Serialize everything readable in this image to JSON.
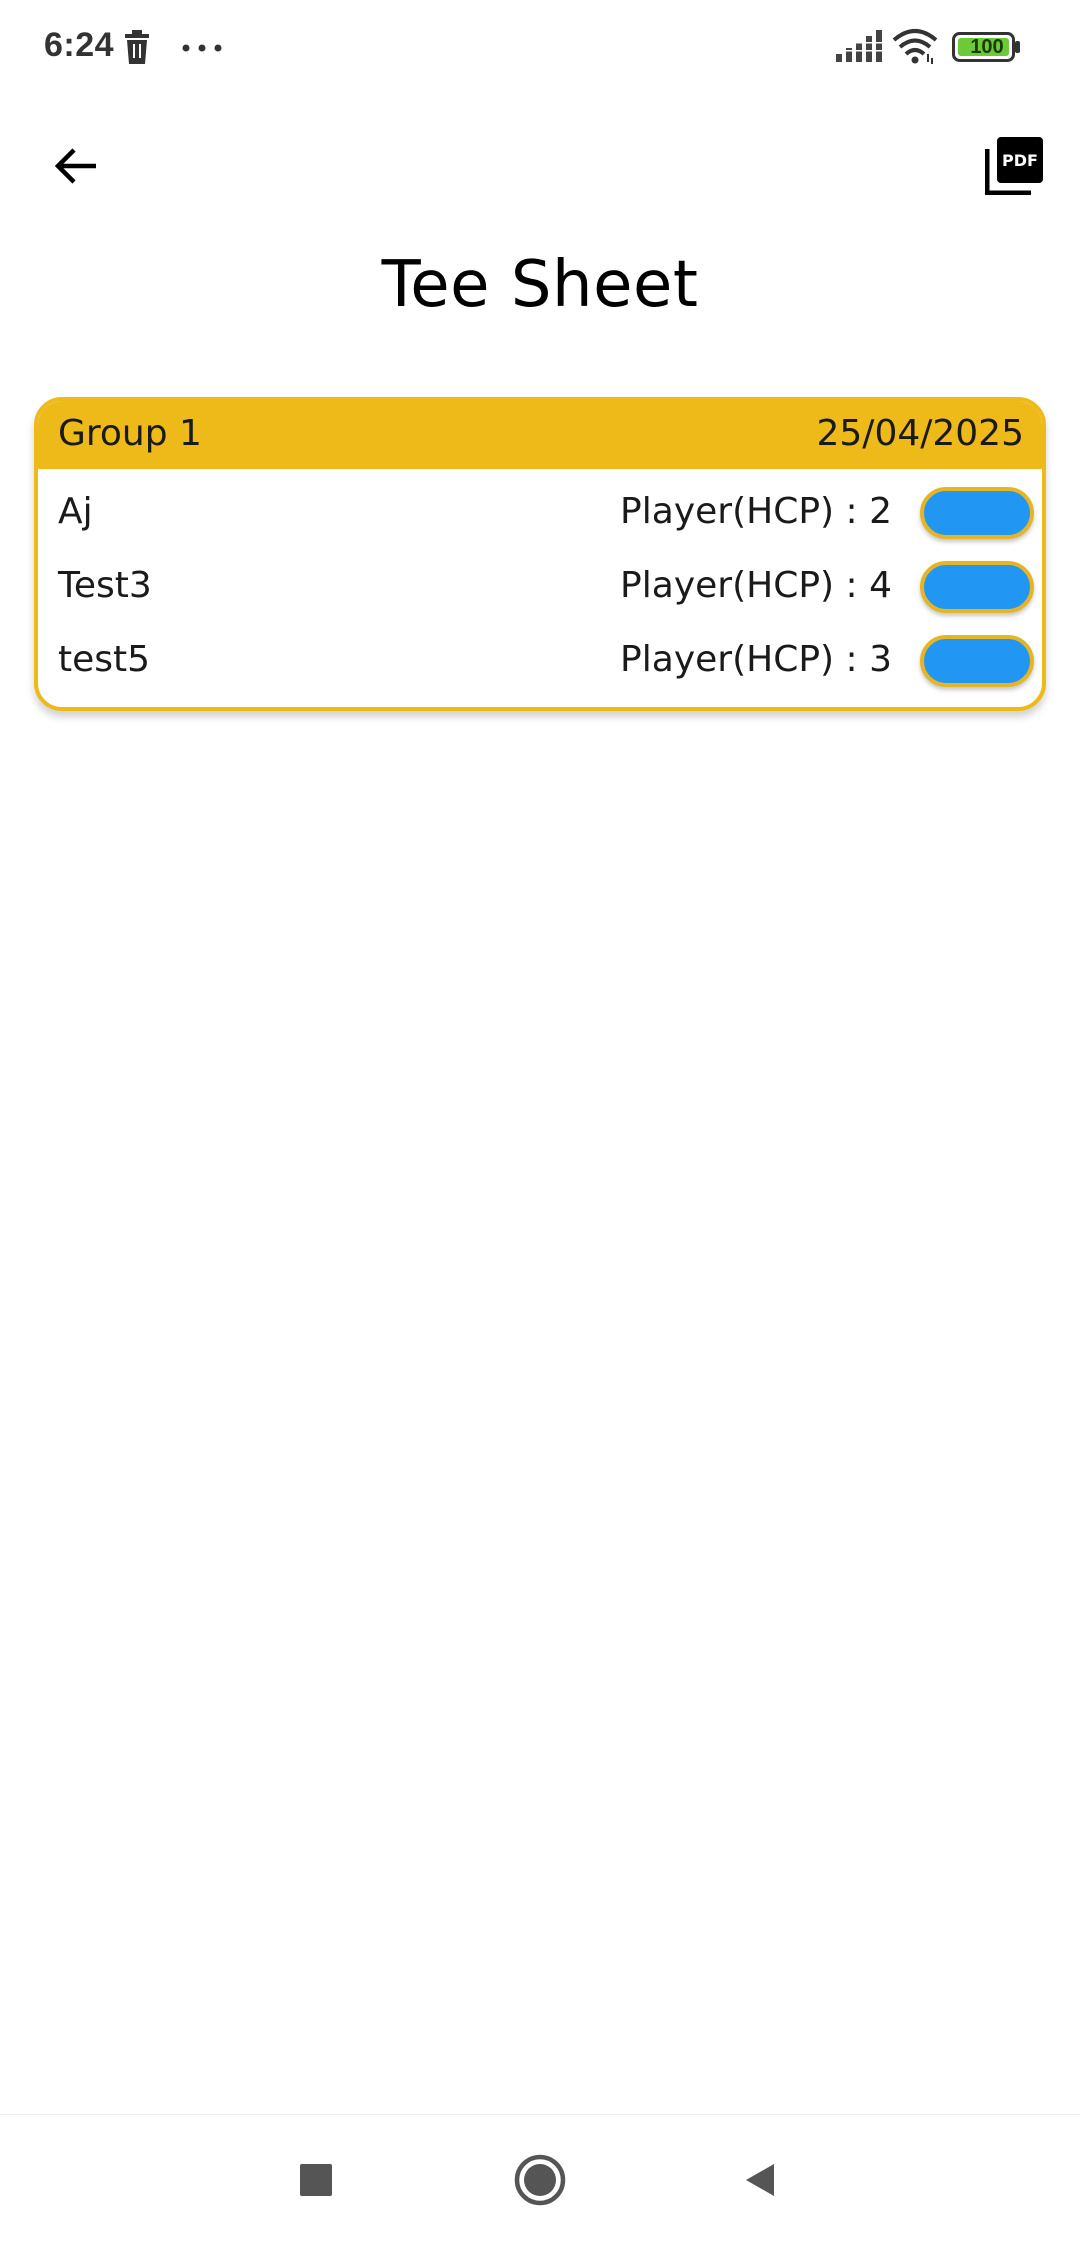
{
  "status_bar": {
    "time": "6:24",
    "battery": "100",
    "icons": [
      "trash-icon",
      "more-dots-icon",
      "signal-icon",
      "wifi-icon",
      "battery-icon"
    ]
  },
  "app_bar": {
    "back_icon": "arrow-back-icon",
    "pdf_icon": "picture-as-pdf-icon",
    "title": "Tee Sheet"
  },
  "group": {
    "name": "Group 1",
    "date": "25/04/2025",
    "header_color": "#EEBA19",
    "players": [
      {
        "name": "Aj",
        "hcp": "Player(HCP) : 2"
      },
      {
        "name": "Test3",
        "hcp": "Player(HCP) : 4"
      },
      {
        "name": "test5",
        "hcp": "Player(HCP) : 3"
      }
    ],
    "action_button_color": "#2196F3"
  },
  "nav_bar": {
    "icons": [
      "recents-square-icon",
      "home-circle-icon",
      "back-triangle-icon"
    ]
  }
}
